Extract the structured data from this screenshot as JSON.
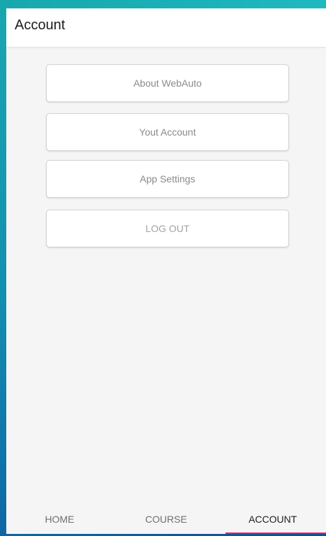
{
  "header": {
    "title": "Account"
  },
  "menu": [
    {
      "label": "About WebAuto"
    },
    {
      "label": "Yout Account"
    },
    {
      "label": "App Settings"
    },
    {
      "label": "LOG OUT"
    }
  ],
  "tabs": [
    {
      "label": "HOME",
      "active": false
    },
    {
      "label": "COURSE",
      "active": false
    },
    {
      "label": "ACCOUNT",
      "active": true
    }
  ],
  "colors": {
    "accent": "#e91e63",
    "background": "#f5f5f5",
    "header": "#ffffff"
  }
}
